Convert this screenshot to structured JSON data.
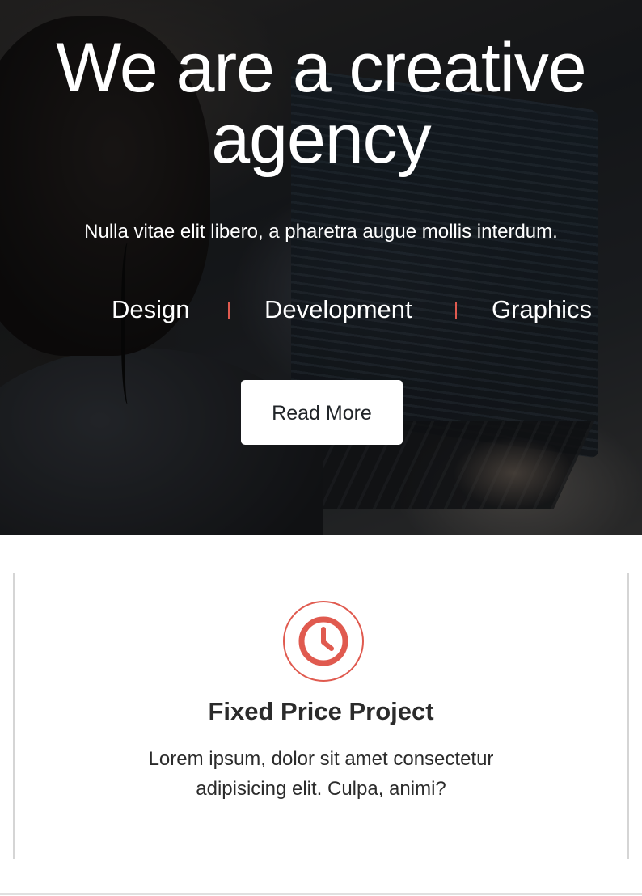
{
  "hero": {
    "title_line1": "We are a creative",
    "title_line2": "agency",
    "subtitle": "Nulla vitae elit libero, a pharetra augue mollis interdum.",
    "services": [
      "Design",
      "Development",
      "Graphics"
    ],
    "button_label": "Read More"
  },
  "feature": {
    "icon": "clock-icon",
    "title": "Fixed Price Project",
    "text_line1": "Lorem ipsum, dolor sit amet consectetur",
    "text_line2": "adipisicing elit. Culpa, animi?"
  },
  "colors": {
    "accent": "#e05a4f",
    "button_bg": "#ffffff",
    "text_dark": "#2b2b2b",
    "card_border": "#d5d5d5"
  }
}
